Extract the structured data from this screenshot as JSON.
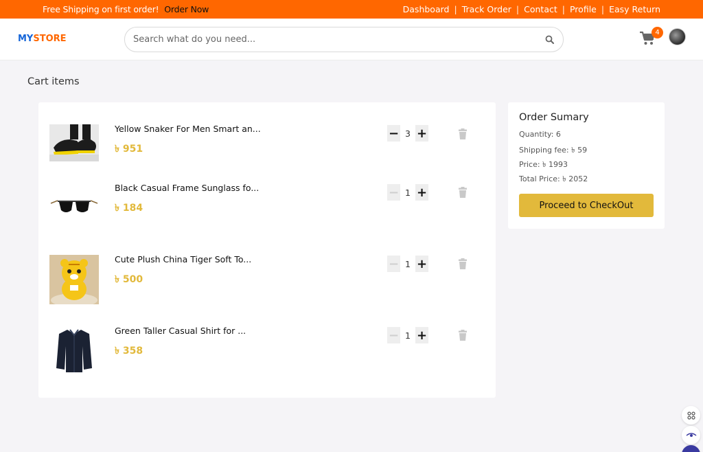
{
  "topbar": {
    "promo": "Free Shipping on first order!",
    "promo_cta": "Order Now",
    "links": [
      "Dashboard",
      "Track Order",
      "Contact",
      "Profile",
      "Easy Return"
    ]
  },
  "header": {
    "logo_my": "MY",
    "logo_store": "STORE",
    "search_placeholder": "Search what do you need...",
    "cart_count": "4"
  },
  "cart": {
    "title": "Cart items",
    "items": [
      {
        "name": "Yellow Snaker For Men Smart an...",
        "price": "৳ 951",
        "qty": "3"
      },
      {
        "name": "Black Casual Frame Sunglass fo...",
        "price": "৳ 184",
        "qty": "1"
      },
      {
        "name": "Cute Plush China Tiger Soft To...",
        "price": "৳ 500",
        "qty": "1"
      },
      {
        "name": "Green Taller Casual Shirt for ...",
        "price": "৳ 358",
        "qty": "1"
      }
    ]
  },
  "summary": {
    "title": "Order Sumary",
    "quantity": "Quantity: 6",
    "shipping": "Shipping fee: ৳ 59",
    "price": "Price: ৳ 1993",
    "total": "Total Price: ৳ 2052",
    "checkout_label": "Proceed to CheckOut"
  },
  "colors": {
    "accent": "#ff6700",
    "brand_blue": "#1565d8",
    "price": "#e2b93b",
    "button": "#e2b93b"
  }
}
